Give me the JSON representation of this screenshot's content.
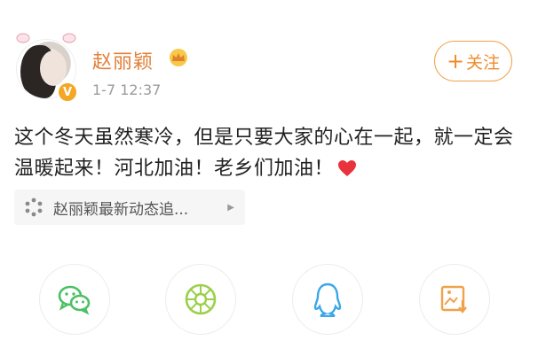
{
  "user": {
    "name": "赵丽颖",
    "badge_letter": "V",
    "timestamp": "1-7 12:37"
  },
  "follow_button": {
    "plus": "+",
    "label": "关注"
  },
  "post": {
    "text": "这个冬天虽然寒冷，但是只要大家的心在一起，就一定会温暖起来！河北加油！老乡们加油！"
  },
  "link_card": {
    "label": "赵丽颖最新动态追...",
    "icon": "weibo-dots-icon",
    "arrow": "▶"
  },
  "share_bar": {
    "items": [
      {
        "name": "wechat",
        "icon": "wechat-icon"
      },
      {
        "name": "moments",
        "icon": "moments-icon"
      },
      {
        "name": "qq",
        "icon": "qq-icon"
      },
      {
        "name": "save-image",
        "icon": "save-image-icon"
      }
    ]
  },
  "colors": {
    "accent": "#f08a2a",
    "username": "#e2813a",
    "text": "#222222",
    "meta": "#9b9b9b",
    "heart": "#e8323c",
    "wechat": "#4cc064",
    "moments": "#9bd04a",
    "qq": "#3aa7e8",
    "save": "#f0a24a"
  }
}
